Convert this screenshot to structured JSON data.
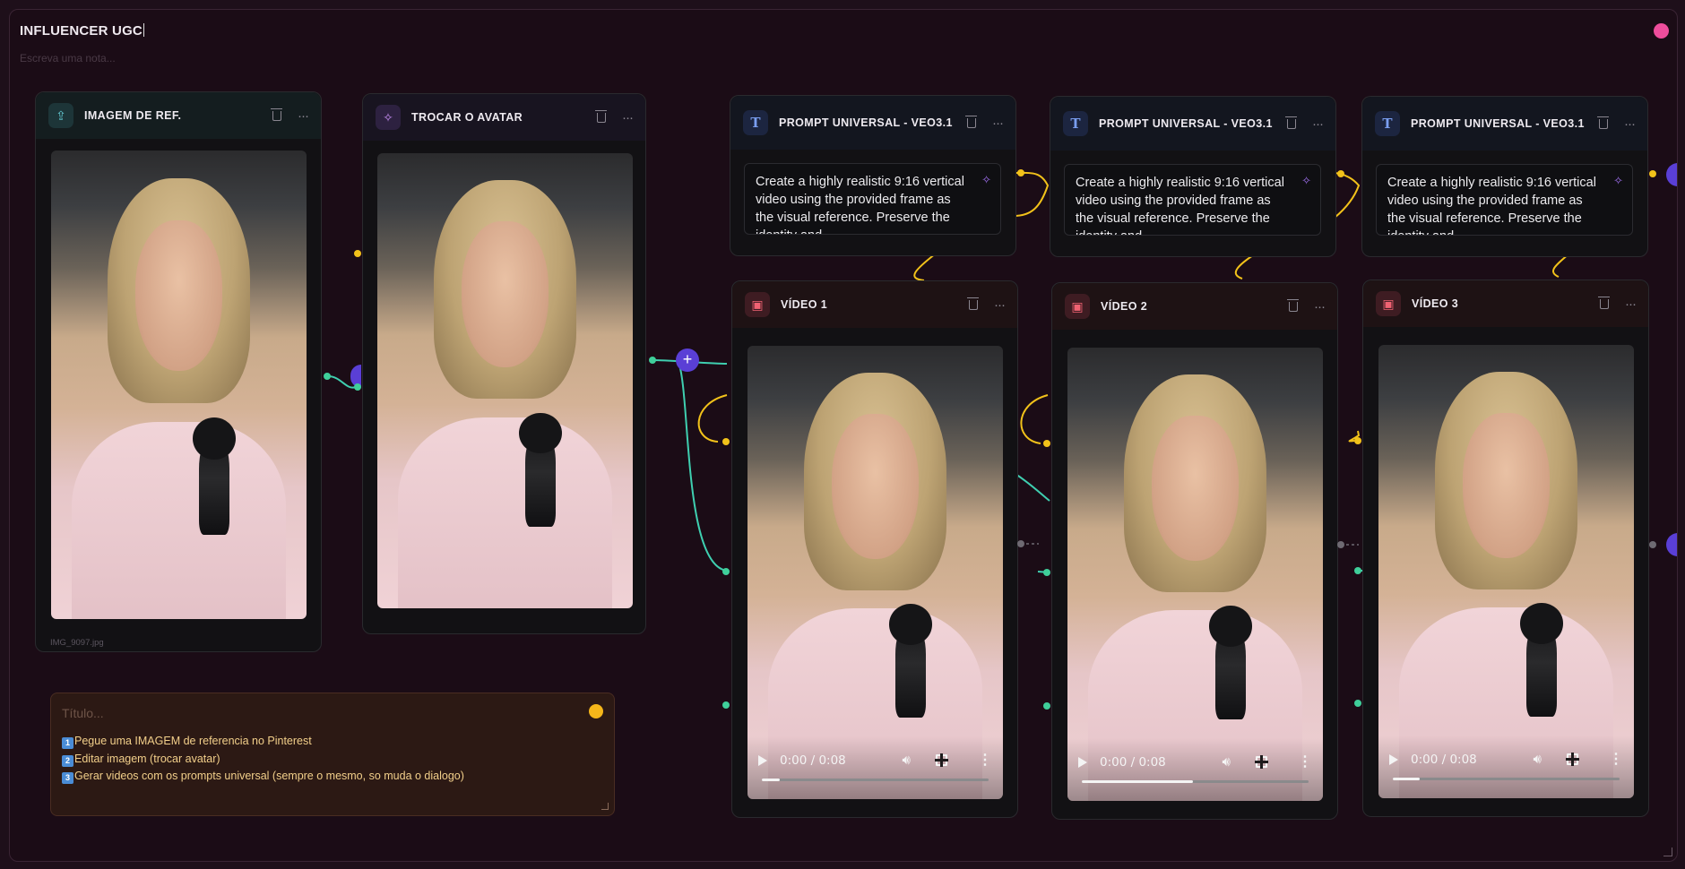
{
  "board": {
    "title": "INFLUENCER UGC",
    "note_placeholder": "Escreva uma nota..."
  },
  "nodes": {
    "ref_image": {
      "title": "IMAGEM DE REF.",
      "icon": "upload-icon",
      "filename": "IMG_9097.jpg"
    },
    "avatar": {
      "title": "TROCAR O AVATAR",
      "icon": "magic-wand-icon"
    },
    "prompts": [
      {
        "title": "PROMPT UNIVERSAL - VEO3.1",
        "icon": "text-icon",
        "text": "Create a highly realistic 9:16 vertical video using the provided frame as the visual reference. Preserve the identity and..."
      },
      {
        "title": "PROMPT UNIVERSAL - VEO3.1",
        "icon": "text-icon",
        "text": "Create a highly realistic 9:16 vertical video using the provided frame as the visual reference. Preserve the identity and..."
      },
      {
        "title": "PROMPT UNIVERSAL - VEO3.1",
        "icon": "text-icon",
        "text": "Create a highly realistic 9:16 vertical video using the provided frame as the visual reference. Preserve the identity and..."
      }
    ],
    "videos": [
      {
        "title": "VÍDEO 1",
        "icon": "film-icon",
        "time": "0:00 / 0:08",
        "progress": 0.08
      },
      {
        "title": "VÍDEO 2",
        "icon": "film-icon",
        "time": "0:00 / 0:08",
        "progress": 0.49
      },
      {
        "title": "VÍDEO 3",
        "icon": "film-icon",
        "time": "0:00 / 0:08",
        "progress": 0.12
      }
    ]
  },
  "sticky": {
    "title_placeholder": "Título...",
    "lines": [
      {
        "badge": "1",
        "text": "Pegue uma IMAGEM de referencia no Pinterest"
      },
      {
        "badge": "2",
        "text": "Editar imagem (trocar avatar)"
      },
      {
        "badge": "3",
        "text": "Gerar videos com os prompts universal (sempre o mesmo, so muda o dialogo)"
      }
    ]
  },
  "colors": {
    "canvas_bg": "#1b0c16",
    "wire_teal": "#3fcfb0",
    "wire_yellow": "#f2c21a",
    "accent_purple": "#5a3fd6",
    "pink_dot": "#ee4d9c",
    "sticky_dot": "#f5b61a"
  }
}
